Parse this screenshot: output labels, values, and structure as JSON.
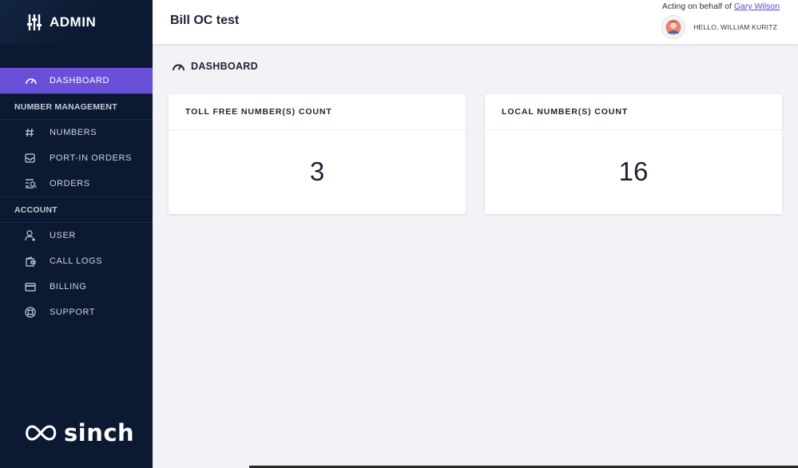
{
  "brand": {
    "title": "ADMIN",
    "logo_text": "sinch"
  },
  "header": {
    "title": "Bill OC test",
    "acting_prefix": "Acting on behalf of",
    "acting_name": "Gary Wilson",
    "greeting": "HELLO, WILLIAM KURITZ"
  },
  "sidebar": {
    "dashboard": {
      "label": "DASHBOARD",
      "icon": "gauge-icon"
    },
    "section_number_management": "NUMBER MANAGEMENT",
    "numbers": {
      "label": "NUMBERS",
      "icon": "hash-icon"
    },
    "port_in_orders": {
      "label": "PORT-IN ORDERS",
      "icon": "inbox-icon"
    },
    "orders": {
      "label": "ORDERS",
      "icon": "list-search-icon"
    },
    "section_account": "ACCOUNT",
    "user": {
      "label": "USER",
      "icon": "user-add-icon"
    },
    "call_logs": {
      "label": "CALL LOGS",
      "icon": "wallet-icon"
    },
    "billing": {
      "label": "BILLING",
      "icon": "credit-card-icon"
    },
    "support": {
      "label": "SUPPORT",
      "icon": "lifebuoy-icon"
    }
  },
  "main": {
    "heading": "DASHBOARD",
    "cards": [
      {
        "title": "TOLL FREE NUMBER(S) COUNT",
        "value": "3"
      },
      {
        "title": "LOCAL NUMBER(S) COUNT",
        "value": "16"
      }
    ]
  },
  "colors": {
    "sidebar_bg": "#0b1a32",
    "accent": "#6a4fd8",
    "link": "#5b48d4",
    "content_bg": "#f3f3f7"
  }
}
